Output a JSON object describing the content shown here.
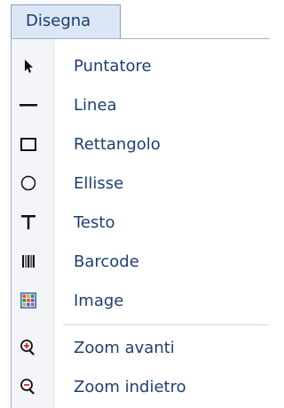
{
  "menu": {
    "title": "Disegna",
    "items": [
      {
        "label": "Puntatore",
        "icon": "pointer-icon"
      },
      {
        "label": "Linea",
        "icon": "line-icon"
      },
      {
        "label": "Rettangolo",
        "icon": "rectangle-icon"
      },
      {
        "label": "Ellisse",
        "icon": "ellipse-icon"
      },
      {
        "label": "Testo",
        "icon": "text-icon"
      },
      {
        "label": "Barcode",
        "icon": "barcode-icon"
      },
      {
        "label": "Image",
        "icon": "image-icon"
      },
      {
        "label": "Zoom avanti",
        "icon": "zoom-in-icon"
      },
      {
        "label": "Zoom indietro",
        "icon": "zoom-out-icon"
      }
    ]
  },
  "colors": {
    "menu_title_bg": "#dbe7f6",
    "label_text": "#1f3f72"
  }
}
